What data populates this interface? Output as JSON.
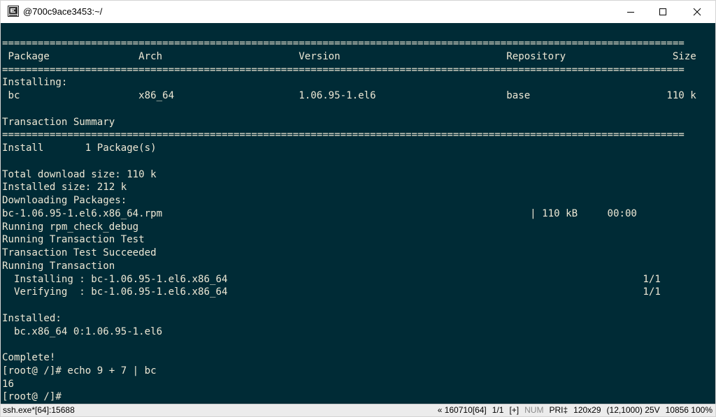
{
  "window": {
    "title": "@700c9ace3453:~/",
    "app_icon": "console-icon",
    "controls": {
      "minimize": "minimize-icon",
      "maximize": "maximize-icon",
      "close": "close-icon"
    }
  },
  "terminal": {
    "colors": {
      "background": "#002b36",
      "foreground": "#eee8d5"
    },
    "lines": [
      "===================================================================================================================",
      " Package               Arch                       Version                            Repository                  Size",
      "===================================================================================================================",
      "Installing:",
      " bc                    x86_64                     1.06.95-1.el6                      base                       110 k",
      "",
      "Transaction Summary",
      "===================================================================================================================",
      "Install       1 Package(s)",
      "",
      "Total download size: 110 k",
      "Installed size: 212 k",
      "Downloading Packages:",
      "bc-1.06.95-1.el6.x86_64.rpm                                                              | 110 kB     00:00",
      "Running rpm_check_debug",
      "Running Transaction Test",
      "Transaction Test Succeeded",
      "Running Transaction",
      "  Installing : bc-1.06.95-1.el6.x86_64                                                                      1/1",
      "  Verifying  : bc-1.06.95-1.el6.x86_64                                                                      1/1",
      "",
      "Installed:",
      "  bc.x86_64 0:1.06.95-1.el6",
      "",
      "Complete!",
      "[root@ /]# echo 9 + 7 | bc",
      "16",
      "[root@ /]#"
    ]
  },
  "statusbar": {
    "process": "ssh.exe*[64]:15688",
    "build": "« 160710[64]",
    "pane": "1/1",
    "plus": "[+]",
    "num": "NUM",
    "pri": "PRI‡",
    "size": "120x29",
    "cursor": "(12,1000) 25V",
    "memory": "10856 100%"
  }
}
